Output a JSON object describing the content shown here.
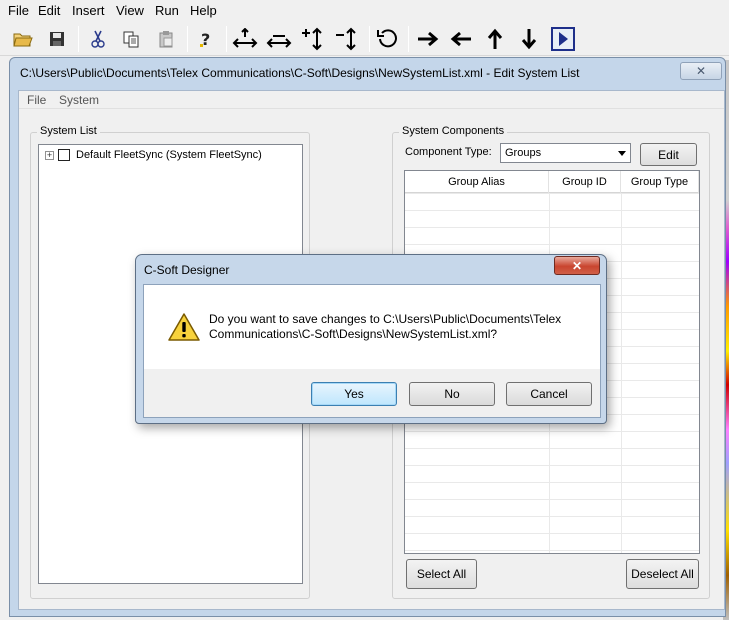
{
  "app": {
    "menu": [
      "File",
      "Edit",
      "Insert",
      "View",
      "Run",
      "Help"
    ],
    "toolbar": [
      "open-icon",
      "save-icon",
      "cut-icon",
      "copy-icon",
      "paste-icon",
      "help-icon",
      "expand-horizontal-icon",
      "shrink-horizontal-icon",
      "expand-vertical-icon",
      "shrink-vertical-icon",
      "rotate-icon",
      "arrow-right-icon",
      "arrow-left-icon",
      "arrow-up-icon",
      "arrow-down-icon",
      "play-icon"
    ]
  },
  "child_window": {
    "title": "C:\\Users\\Public\\Documents\\Telex Communications\\C-Soft\\Designs\\NewSystemList.xml - Edit System List",
    "close_glyph": "✕",
    "menu": [
      "File",
      "System"
    ],
    "system_list": {
      "label": "System List",
      "tree_item": "Default FleetSync  (System FleetSync)"
    },
    "system_components": {
      "label": "System Components",
      "component_type_label": "Component Type:",
      "component_type_value": "Groups",
      "edit_button": "Edit",
      "columns": [
        "Group Alias",
        "Group ID",
        "Group Type"
      ],
      "select_all": "Select All",
      "deselect_all": "Deselect All"
    }
  },
  "dialog": {
    "title": "C-Soft Designer",
    "close_glyph": "✕",
    "message_line1": "Do you want to save changes to C:\\Users\\Public\\Documents\\Telex",
    "message_line2": "Communications\\C-Soft\\Designs\\NewSystemList.xml?",
    "yes": "Yes",
    "no": "No",
    "cancel": "Cancel"
  },
  "colors": {
    "title_blue": "#c4d6ea",
    "default_button": "#bee6fd",
    "close_red": "#c9452f"
  }
}
